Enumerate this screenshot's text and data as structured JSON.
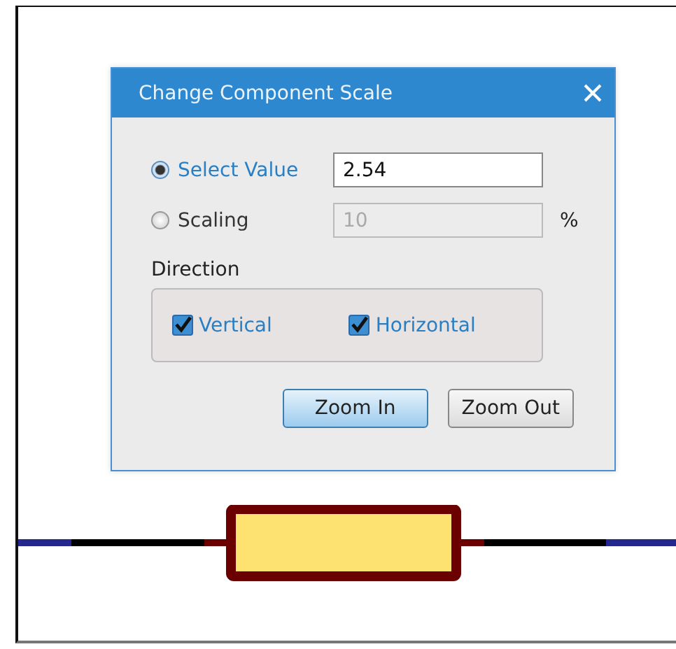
{
  "dialog": {
    "title": "Change Component Scale",
    "options": [
      {
        "label": "Select Value",
        "selected": true,
        "value": "2.54",
        "disabled": false
      },
      {
        "label": "Scaling",
        "selected": false,
        "value": "10",
        "disabled": true,
        "suffix": "%"
      }
    ],
    "direction": {
      "label": "Direction",
      "options": [
        {
          "label": "Vertical",
          "checked": true
        },
        {
          "label": "Horizontal",
          "checked": true
        }
      ]
    },
    "buttons": [
      {
        "label": "Zoom In",
        "default": true
      },
      {
        "label": "Zoom Out",
        "default": false
      }
    ]
  }
}
